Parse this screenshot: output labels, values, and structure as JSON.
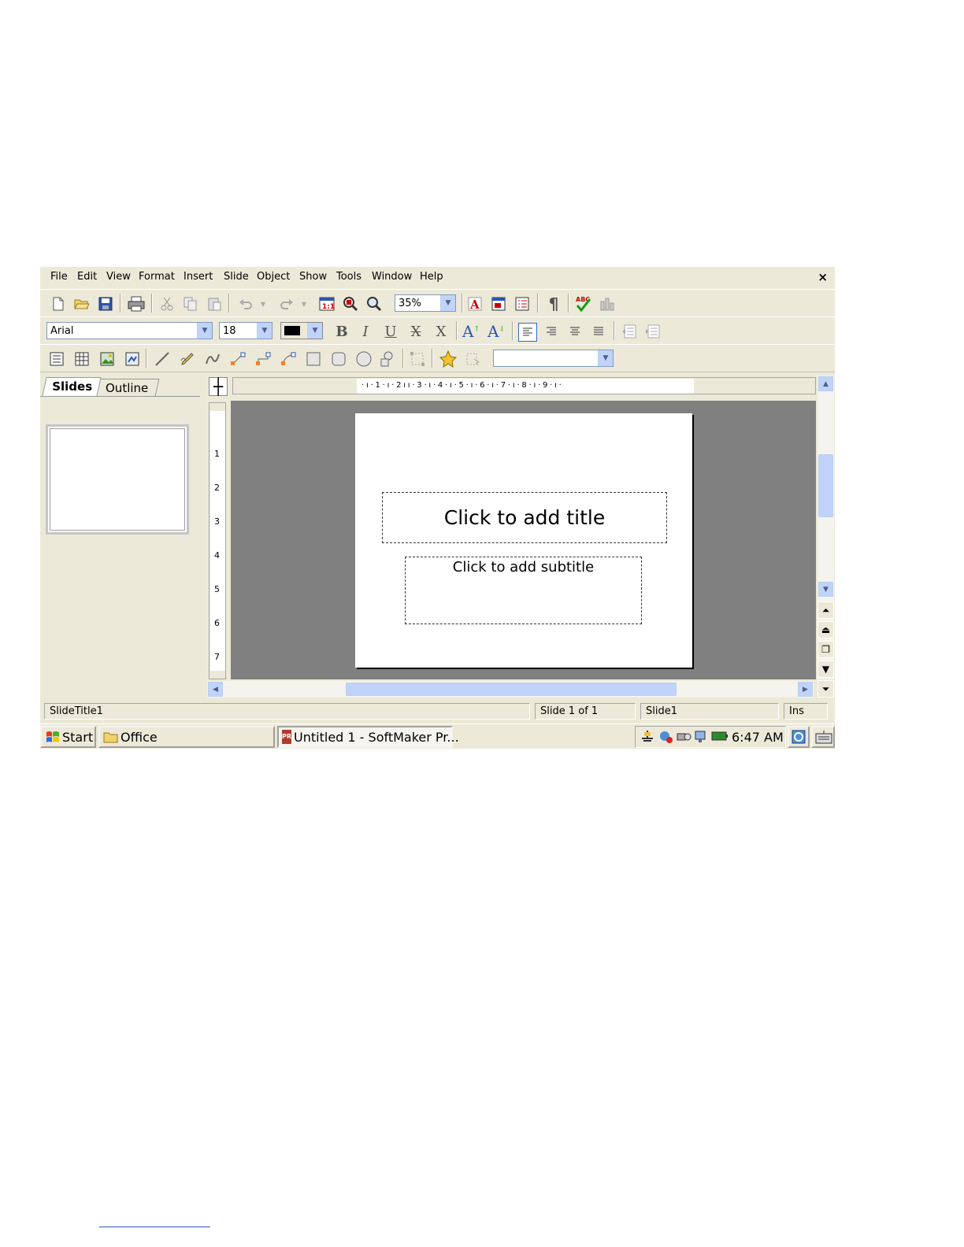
{
  "menu": [
    "File",
    "Edit",
    "View",
    "Format",
    "Insert",
    "Slide",
    "Object",
    "Show",
    "Tools",
    "Window",
    "Help"
  ],
  "close_symbol": "×",
  "toolbar": {
    "zoom_value": "35%",
    "font_name": "Arial",
    "font_size": "18",
    "font_color": "#000000"
  },
  "panel": {
    "tabs": [
      "Slides",
      "Outline"
    ]
  },
  "ruler": {
    "horizontal": "· ı · 1 · ı · 2 ı ı · 3 · ı · 4 · ı · 5 · ı · 6 · ı · 7 · ı · 8 · ı · 9 · ı ·",
    "vertical_numbers": [
      "1",
      "2",
      "3",
      "4",
      "5",
      "6",
      "7"
    ]
  },
  "slide": {
    "title_placeholder": "Click to add title",
    "subtitle_placeholder": "Click to add subtitle"
  },
  "status": {
    "object": "SlideTitle1",
    "position": "Slide 1 of 1",
    "slide_name": "Slide1",
    "mode": "Ins"
  },
  "taskbar": {
    "start": "Start",
    "folder": "Office",
    "app_icon_text": "PR",
    "window": "Untitled 1 - SoftMaker Pr...",
    "time": "6:47 AM"
  }
}
